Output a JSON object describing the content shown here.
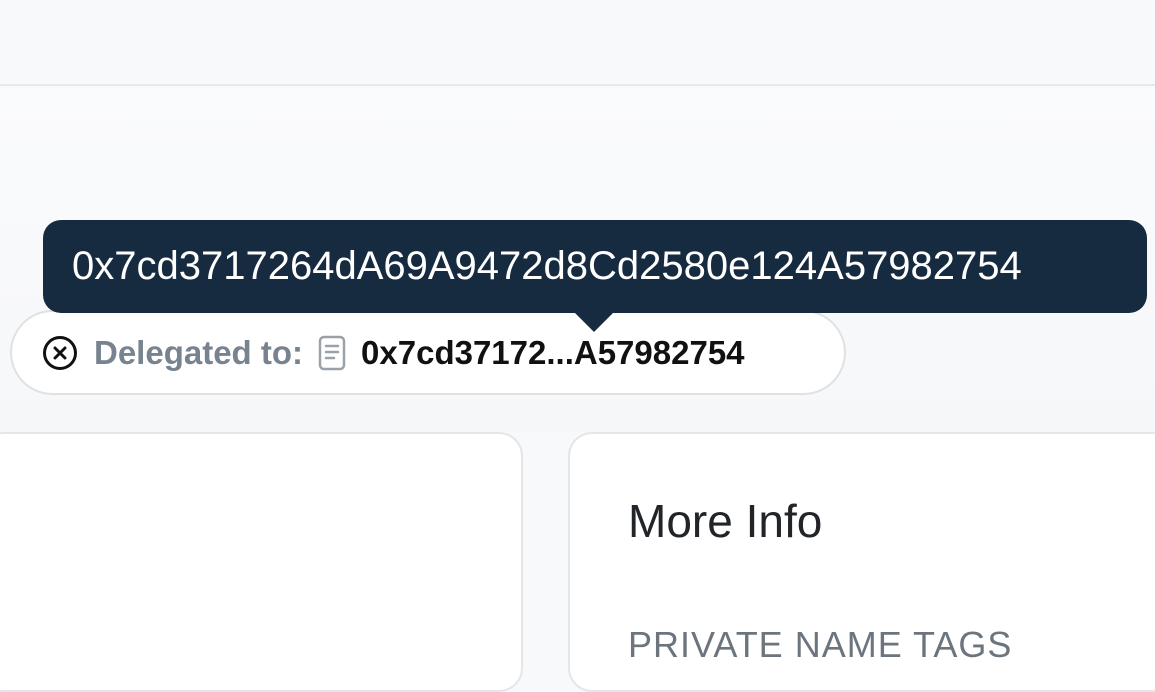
{
  "tooltip": {
    "full_address": "0x7cd3717264dA69A9472d8Cd2580e124A57982754"
  },
  "delegation": {
    "status_icon": "x-circle-icon",
    "label": "Delegated to:",
    "contract_icon": "document-icon",
    "short_address": "0x7cd37172...A57982754"
  },
  "more_info": {
    "title": "More Info",
    "section_label": "PRIVATE NAME TAGS"
  },
  "colors": {
    "tooltip_bg": "#172b40",
    "label_gray": "#77838f",
    "card_border": "#e4e6ea"
  }
}
